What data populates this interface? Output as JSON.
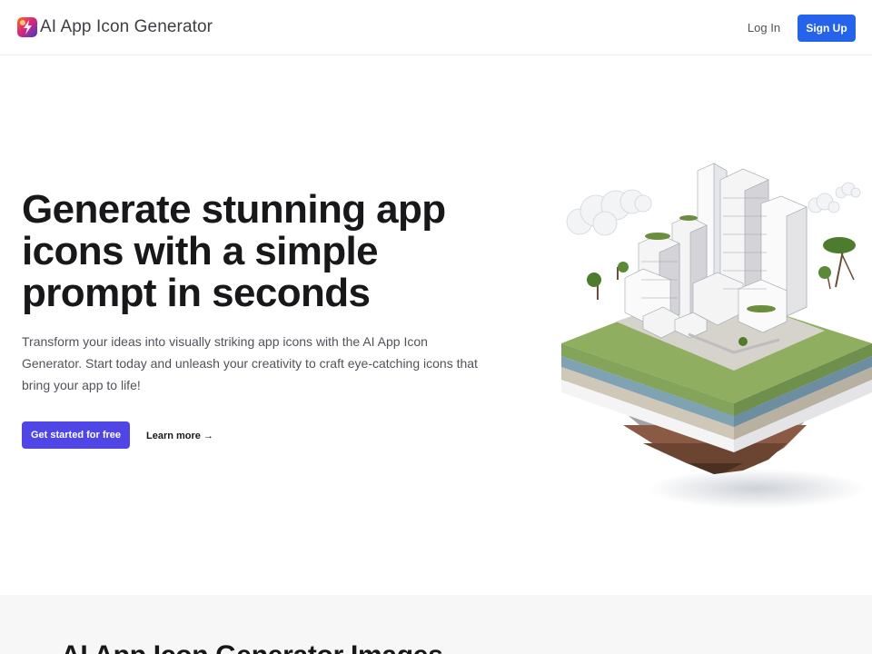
{
  "header": {
    "brand_name": "AI App Icon Generator",
    "login_label": "Log In",
    "signup_label": "Sign Up"
  },
  "hero": {
    "title": "Generate stunning app icons with a simple prompt in seconds",
    "description": "Transform your ideas into visually striking app icons with the AI App Icon Generator. Start today and unleash your creativity to craft eye-catching icons that bring your app to life!",
    "cta_label": "Get started for free",
    "learn_more_label": "Learn more →"
  },
  "gallery": {
    "title": "AI App Icon Generator Images"
  },
  "colors": {
    "primary_button": "#2563eb",
    "cta_button": "#4f46e5",
    "heading": "#18181b",
    "body_text": "#52525b"
  }
}
